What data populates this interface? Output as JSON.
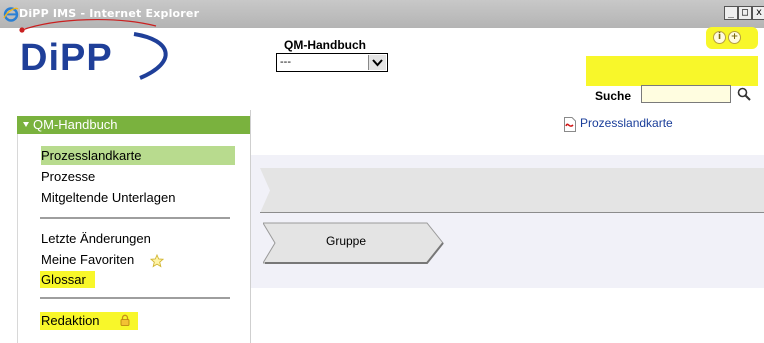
{
  "window": {
    "title": "DiPP IMS - Internet Explorer",
    "controls": [
      "_",
      "□",
      "x"
    ]
  },
  "header": {
    "logo_text": "DiPP",
    "qm_label": "QM-Handbuch",
    "qm_select_value": "---",
    "search_label": "Suche",
    "search_value": ""
  },
  "sidebar": {
    "section_title": "QM-Handbuch",
    "items": [
      {
        "label": "Prozesslandkarte"
      },
      {
        "label": "Prozesse"
      },
      {
        "label": "Mitgeltende Unterlagen"
      }
    ],
    "secondary": [
      {
        "label": "Letzte Änderungen"
      },
      {
        "label": "Meine Favoriten"
      },
      {
        "label": "Glossar"
      }
    ],
    "admin": {
      "label": "Redaktion"
    }
  },
  "main": {
    "pdf_link": "Prozesslandkarte",
    "group_label": "Gruppe"
  },
  "colors": {
    "sidebar_header": "#7ab23e",
    "active_item": "#b8db8e",
    "highlight": "#f8f72a",
    "link": "#1a3e9a",
    "logo_blue": "#1f3f99"
  }
}
